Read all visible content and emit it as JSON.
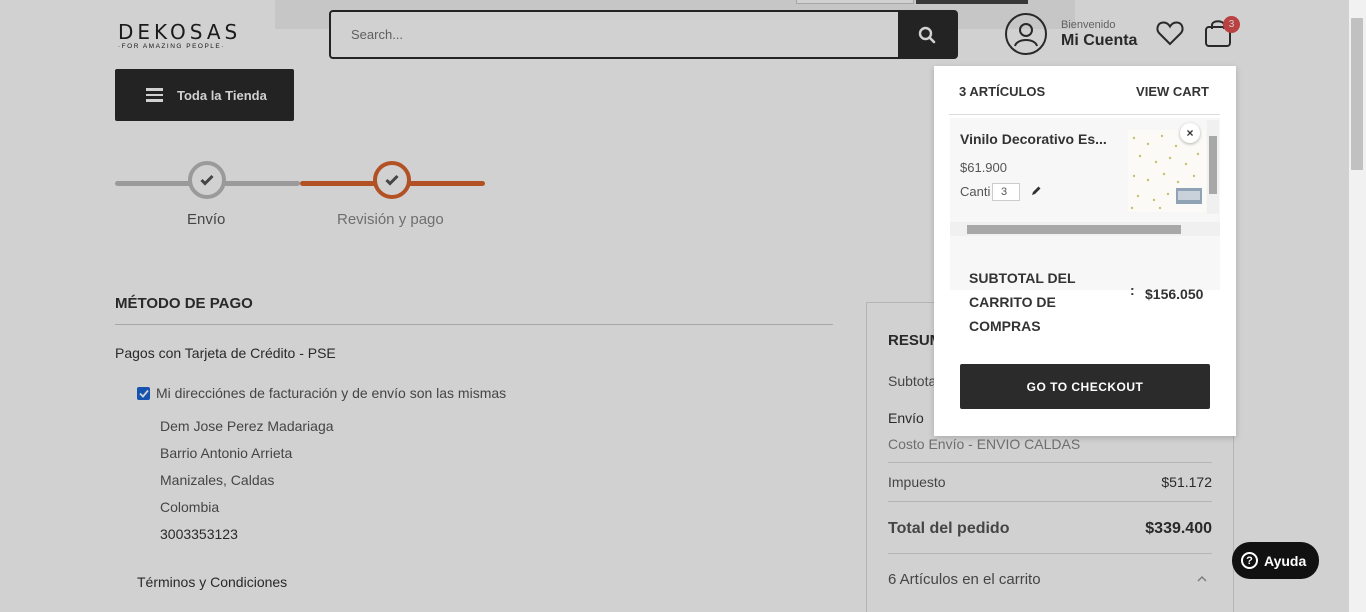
{
  "header": {
    "logo_main": "DEKOSAS",
    "logo_sub": "·FOR AMAZING PEOPLE·",
    "search_placeholder": "Search...",
    "welcome": "Bienvenido",
    "account_name": "Mi Cuenta",
    "cart_count": "3",
    "store_button": "Toda la Tienda"
  },
  "progress": {
    "steps": [
      "Envío",
      "Revisión y pago"
    ],
    "active_step": 2
  },
  "payment": {
    "title": "MÉTODO DE PAGO",
    "method": "Pagos con Tarjeta de Crédito - PSE",
    "same_address_label": "Mi direcciónes de facturación y de envío son las mismas",
    "same_address_checked": true,
    "address_lines": [
      "Dem Jose Perez Madariaga",
      "Barrio Antonio Arrieta",
      "Manizales, Caldas",
      "Colombia",
      "3003353123"
    ],
    "terms": "Términos y Condiciones"
  },
  "summary": {
    "title": "RESUM",
    "subtotal_label": "Subtota",
    "shipping_label": "Envío",
    "shipping_method": "Costo Envío - ENVIO CALDAS",
    "tax_label": "Impuesto",
    "tax_value": "$51.172",
    "total_label": "Total del pedido",
    "total_value": "$339.400",
    "items_in_cart": "6 Artículos en el carrito"
  },
  "minicart": {
    "items_label": "3 ARTÍCULOS",
    "view_cart": "VIEW CART",
    "item": {
      "name": "Vinilo Decorativo Es...",
      "price": "$61.900",
      "qty_label": "Canti",
      "qty": "3"
    },
    "subtotal_label": "SUBTOTAL DEL CARRITO DE COMPRAS",
    "subtotal_colon": ":",
    "subtotal_value": "$156.050",
    "checkout": "GO TO CHECKOUT"
  },
  "help": {
    "label": "Ayuda",
    "q_mark": "?"
  },
  "colors": {
    "accent_orange": "#d9632b",
    "dark": "#2b2b2b",
    "badge_red": "#e35050",
    "checkbox_blue": "#1a66d6"
  }
}
